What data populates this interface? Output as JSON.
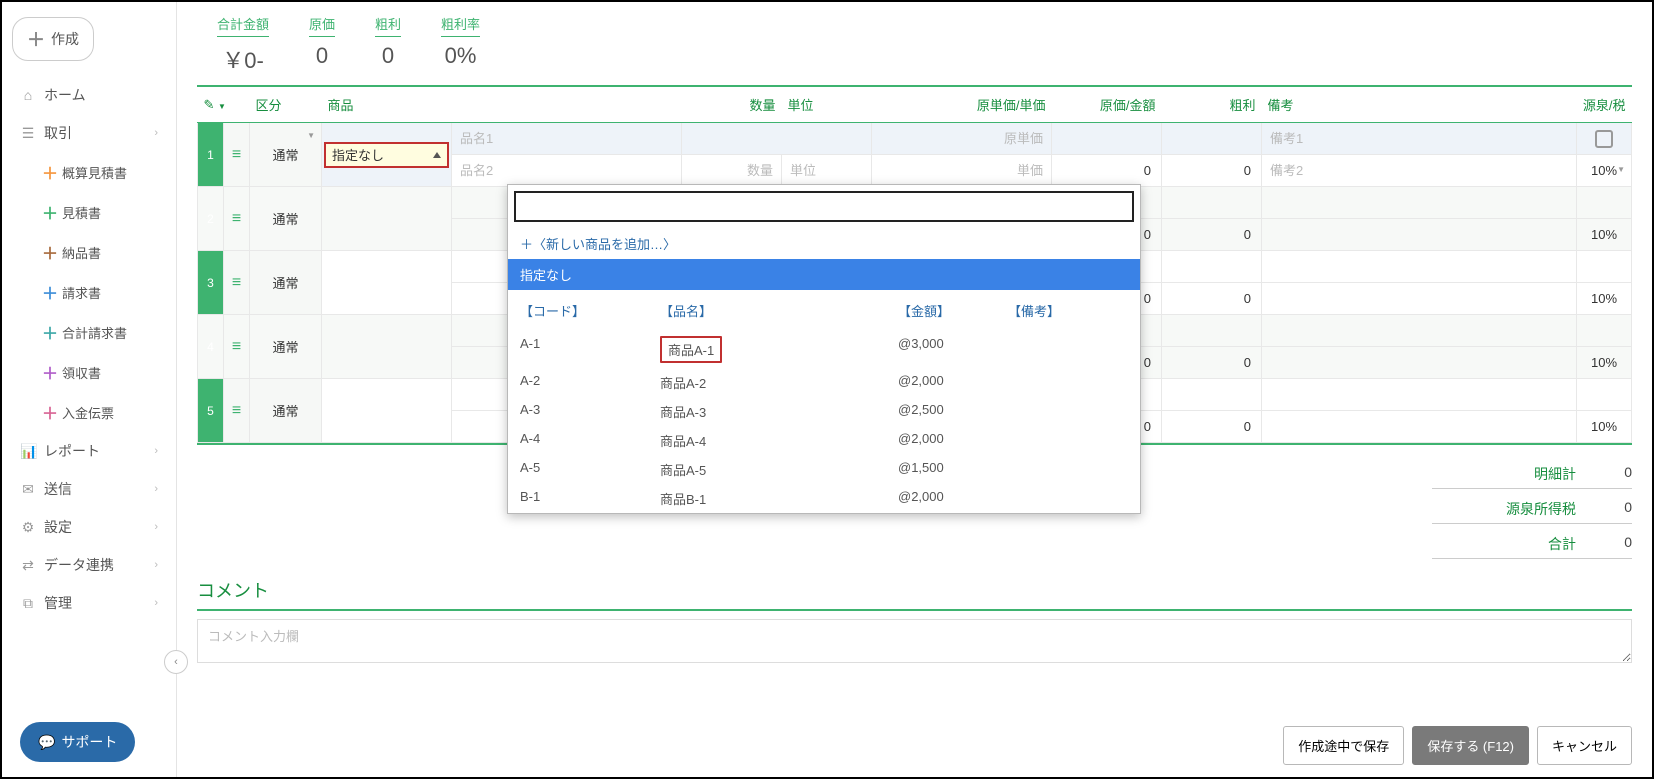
{
  "sidebar": {
    "create": "作成",
    "items": [
      {
        "icon": "⌂",
        "label": "ホーム"
      },
      {
        "icon": "☰",
        "label": "取引",
        "chev": true
      }
    ],
    "subs": [
      {
        "cls": "plus-orange",
        "label": "概算見積書"
      },
      {
        "cls": "plus-green",
        "label": "見積書"
      },
      {
        "cls": "plus-brown",
        "label": "納品書"
      },
      {
        "cls": "plus-blue",
        "label": "請求書"
      },
      {
        "cls": "plus-teal",
        "label": "合計請求書"
      },
      {
        "cls": "plus-purple",
        "label": "領収書"
      },
      {
        "cls": "plus-pink",
        "label": "入金伝票"
      }
    ],
    "items2": [
      {
        "icon": "📊",
        "label": "レポート",
        "chev": true
      },
      {
        "icon": "✉",
        "label": "送信",
        "chev": true
      },
      {
        "icon": "⚙",
        "label": "設定",
        "chev": true
      },
      {
        "icon": "⇄",
        "label": "データ連携",
        "chev": true
      },
      {
        "icon": "⧉",
        "label": "管理",
        "chev": true
      }
    ],
    "support": "サポート"
  },
  "summary": {
    "total": {
      "lbl": "合計金額",
      "val": "￥0-"
    },
    "cost": {
      "lbl": "原価",
      "val": "0"
    },
    "gross": {
      "lbl": "粗利",
      "val": "0"
    },
    "rate": {
      "lbl": "粗利率",
      "val": "0%"
    }
  },
  "headers": {
    "edit": "✎",
    "kubun": "区分",
    "product": "商品",
    "qty": "数量",
    "unit": "単位",
    "unitcost": "原単価/単価",
    "costamt": "原価/金額",
    "gross": "粗利",
    "note": "備考",
    "tax": "源泉/税"
  },
  "rows": [
    {
      "idx": "1",
      "kind": "通常",
      "pick": "指定なし",
      "p1": "品名1",
      "p2": "品名2",
      "qty": "数量",
      "unit": "単位",
      "uc": "原単価",
      "up": "単価",
      "amt1": "0",
      "amt2": "0",
      "note1": "備考1",
      "note2": "備考2",
      "tax": "10%",
      "chk": true
    },
    {
      "idx": "2",
      "kind": "通常",
      "amt1": "0",
      "amt2": "0",
      "tax": "10%"
    },
    {
      "idx": "3",
      "kind": "通常",
      "amt1": "0",
      "amt2": "0",
      "tax": "10%"
    },
    {
      "idx": "4",
      "kind": "通常",
      "amt1": "0",
      "amt2": "0",
      "tax": "10%"
    },
    {
      "idx": "5",
      "kind": "通常",
      "amt1": "0",
      "amt2": "0",
      "tax": "10%"
    }
  ],
  "dropdown": {
    "add_new": "＋〈新しい商品を追加…〉",
    "selected": "指定なし",
    "hdr": {
      "code": "【コード】",
      "name": "【品名】",
      "amt": "【金額】",
      "note": "【備考】"
    },
    "rows": [
      {
        "code": "A-1",
        "name": "商品A-1",
        "amt": "@3,000"
      },
      {
        "code": "A-2",
        "name": "商品A-2",
        "amt": "@2,000"
      },
      {
        "code": "A-3",
        "name": "商品A-3",
        "amt": "@2,500"
      },
      {
        "code": "A-4",
        "name": "商品A-4",
        "amt": "@2,000"
      },
      {
        "code": "A-5",
        "name": "商品A-5",
        "amt": "@1,500"
      },
      {
        "code": "B-1",
        "name": "商品B-1",
        "amt": "@2,000"
      }
    ]
  },
  "totals": {
    "sub": {
      "lbl": "明細計",
      "val": "0"
    },
    "with": {
      "lbl": "源泉所得税",
      "val": "0"
    },
    "grand": {
      "lbl": "合計",
      "val": "0"
    }
  },
  "comment": {
    "title": "コメント",
    "placeholder": "コメント入力欄"
  },
  "footer": {
    "draft": "作成途中で保存",
    "save": "保存する (F12)",
    "cancel": "キャンセル"
  }
}
